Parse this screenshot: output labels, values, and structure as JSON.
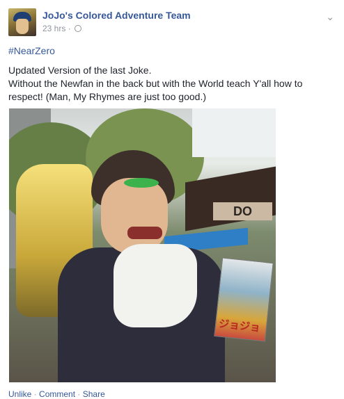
{
  "post": {
    "page_name": "JoJo's Colored Adventure Team",
    "time": "23 hrs",
    "separator": "·",
    "hashtag": "#NearZero",
    "text_line1": "Updated Version of the last Joke.",
    "text_line2": "Without the Newfan in the back but with the World teach Y'all how to respect! (Man, My Rhymes are just too good.)",
    "menu_icon": "chevron-down-icon",
    "privacy_icon": "globe-icon"
  },
  "photo": {
    "sign_text": "DO"
  },
  "actions": {
    "unlike": "Unlike",
    "comment": "Comment",
    "share": "Share",
    "dot": "·"
  },
  "colors": {
    "link": "#365899",
    "meta": "#90949c",
    "text": "#1d2129"
  }
}
